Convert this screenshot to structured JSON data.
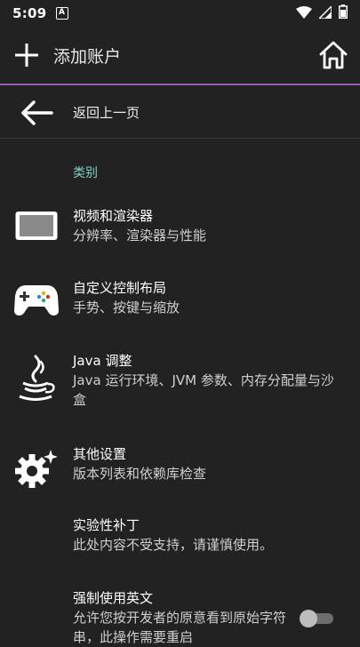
{
  "status": {
    "time": "5:09",
    "notif_letter": "A"
  },
  "appbar": {
    "title": "添加账户"
  },
  "back": {
    "label": "返回上一页"
  },
  "section": {
    "header": "类别"
  },
  "items": [
    {
      "title": "视频和渲染器",
      "subtitle": "分辨率、渲染器与性能"
    },
    {
      "title": "自定义控制布局",
      "subtitle": "手势、按键与缩放"
    },
    {
      "title": "Java 调整",
      "subtitle": "Java 运行环境、JVM 参数、内存分配量与沙盒"
    },
    {
      "title": "其他设置",
      "subtitle": "版本列表和依赖库检查"
    },
    {
      "title": "实验性补丁",
      "subtitle": "此处内容不受支持，请谨慎使用。"
    },
    {
      "title": "强制使用英文",
      "subtitle": "允许您按开发者的原意看到原始字符串，此操作需要重启"
    }
  ],
  "toggle": {
    "force_english_on": false
  },
  "colors": {
    "accent_line": "#9b59b6",
    "section_header": "#7fd3c4",
    "background": "#222222"
  }
}
